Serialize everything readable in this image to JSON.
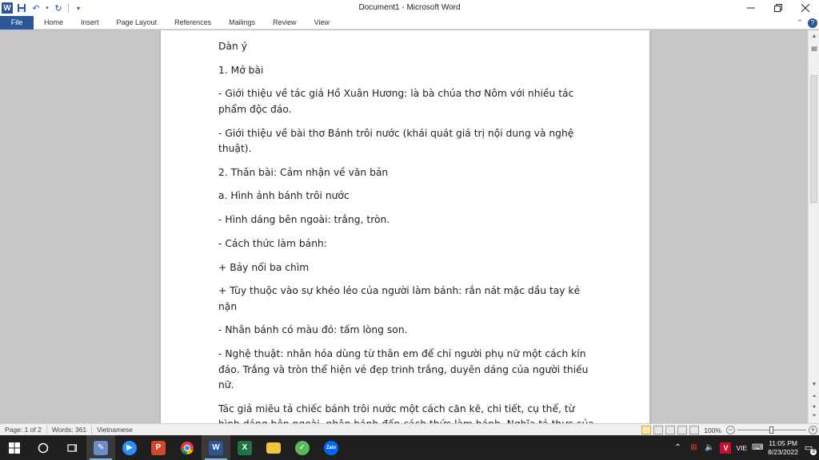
{
  "titlebar": {
    "title": "Document1 - Microsoft Word",
    "app_icon": "W"
  },
  "ribbon": {
    "file_label": "File",
    "tabs": [
      "Home",
      "Insert",
      "Page Layout",
      "References",
      "Mailings",
      "Review",
      "View"
    ]
  },
  "document": {
    "paragraphs": [
      "Dàn ý",
      "1. Mở bài",
      "- Giới thiệu về tác giả Hồ Xuân Hương: là bà chúa thơ Nôm với nhiều tác phẩm độc đáo.",
      "- Giới thiệu về bài thơ Bánh trôi nước (khái quát giá trị nội dung và nghệ thuật).",
      "2. Thân bài: Cảm nhận về văn bản",
      "a. Hình ảnh bánh trôi nước",
      "- Hình dáng bên ngoài: trắng, tròn.",
      "- Cách thức làm bánh:",
      "+ Bảy nổi ba chìm",
      "+ Tùy thuộc vào sự khéo léo của người làm bánh: rắn nát mặc dầu tay kẻ nặn",
      "- Nhân bánh có màu đỏ: tấm lòng son.",
      "- Nghệ thuật: nhân hóa dùng từ thân em để chỉ người phụ nữ một cách kín đáo. Trắng và tròn thể hiện vẻ đẹp trinh trắng, duyên dáng của người thiếu nữ.",
      "Tác giả miêu tả chiếc bánh trôi nước một cách căn kẽ, chi tiết, cụ thể, từ hình dáng bên ngoài, nhân bánh đến cách thức làm bánh. Nghĩa tả thực của bài thơ là hình ảnh chiếc bánh trôi nước trắng, tròn và luộc chưa chín thì chìm, chín rồi thì nổi."
    ]
  },
  "statusbar": {
    "page": "Page: 1 of 2",
    "words": "Words: 361",
    "language": "Vietnamese",
    "zoom": "100%",
    "zoom_level": 100
  },
  "taskbar": {
    "language": "VIE",
    "time": "11:05 PM",
    "date": "8/23/2022",
    "notification_count": "3"
  },
  "colors": {
    "word_blue": "#2b579a",
    "taskbar": "#1f1f1f",
    "doc_background": "#c6c6c6"
  }
}
